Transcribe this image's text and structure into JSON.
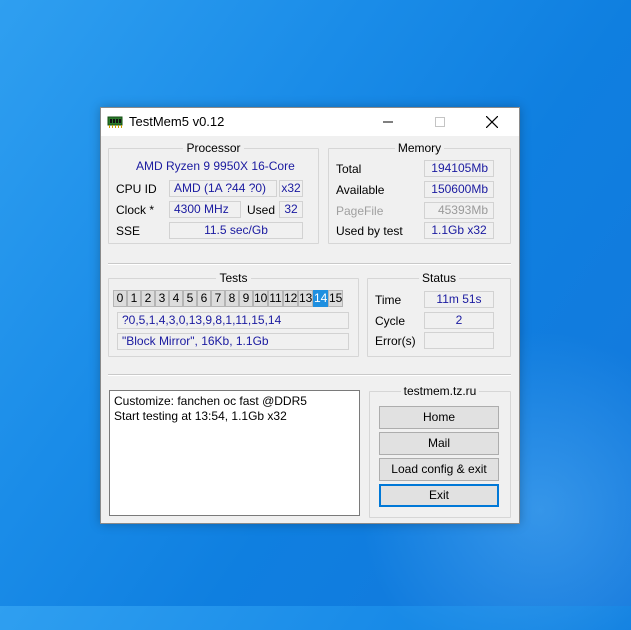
{
  "window": {
    "title": "TestMem5 v0.12"
  },
  "processor": {
    "legend": "Processor",
    "name": "AMD Ryzen 9 9950X 16-Core",
    "cpuid_label": "CPU ID",
    "cpuid_value": "AMD  (1A ?44 ?0)",
    "cpuid_x": "x32",
    "clock_label": "Clock *",
    "clock_value": "4300 MHz",
    "used_label": "Used",
    "used_value": "32",
    "sse_label": "SSE",
    "sse_value": "11.5 sec/Gb"
  },
  "memory": {
    "legend": "Memory",
    "total_label": "Total",
    "total_value": "194105Mb",
    "available_label": "Available",
    "available_value": "150600Mb",
    "pagefile_label": "PageFile",
    "pagefile_value": "45393Mb",
    "usedby_label": "Used by test",
    "usedby_value": "1.1Gb x32"
  },
  "tests": {
    "legend": "Tests",
    "cells": [
      "0",
      "1",
      "2",
      "3",
      "4",
      "5",
      "6",
      "7",
      "8",
      "9",
      "10",
      "11",
      "12",
      "13",
      "14",
      "15"
    ],
    "active": "14",
    "sequence": "?0,5,1,4,3,0,13,9,8,1,11,15,14",
    "current": "\"Block Mirror\", 16Kb, 1.1Gb"
  },
  "status": {
    "legend": "Status",
    "time_label": "Time",
    "time_value": "11m 51s",
    "cycle_label": "Cycle",
    "cycle_value": "2",
    "errors_label": "Error(s)",
    "errors_value": ""
  },
  "log": {
    "lines": [
      "Customize: fanchen oc fast @DDR5",
      "Start testing at 13:54, 1.1Gb x32"
    ]
  },
  "links": {
    "site": "testmem.tz.ru",
    "home": "Home",
    "mail": "Mail",
    "load": "Load config & exit",
    "exit": "Exit"
  }
}
